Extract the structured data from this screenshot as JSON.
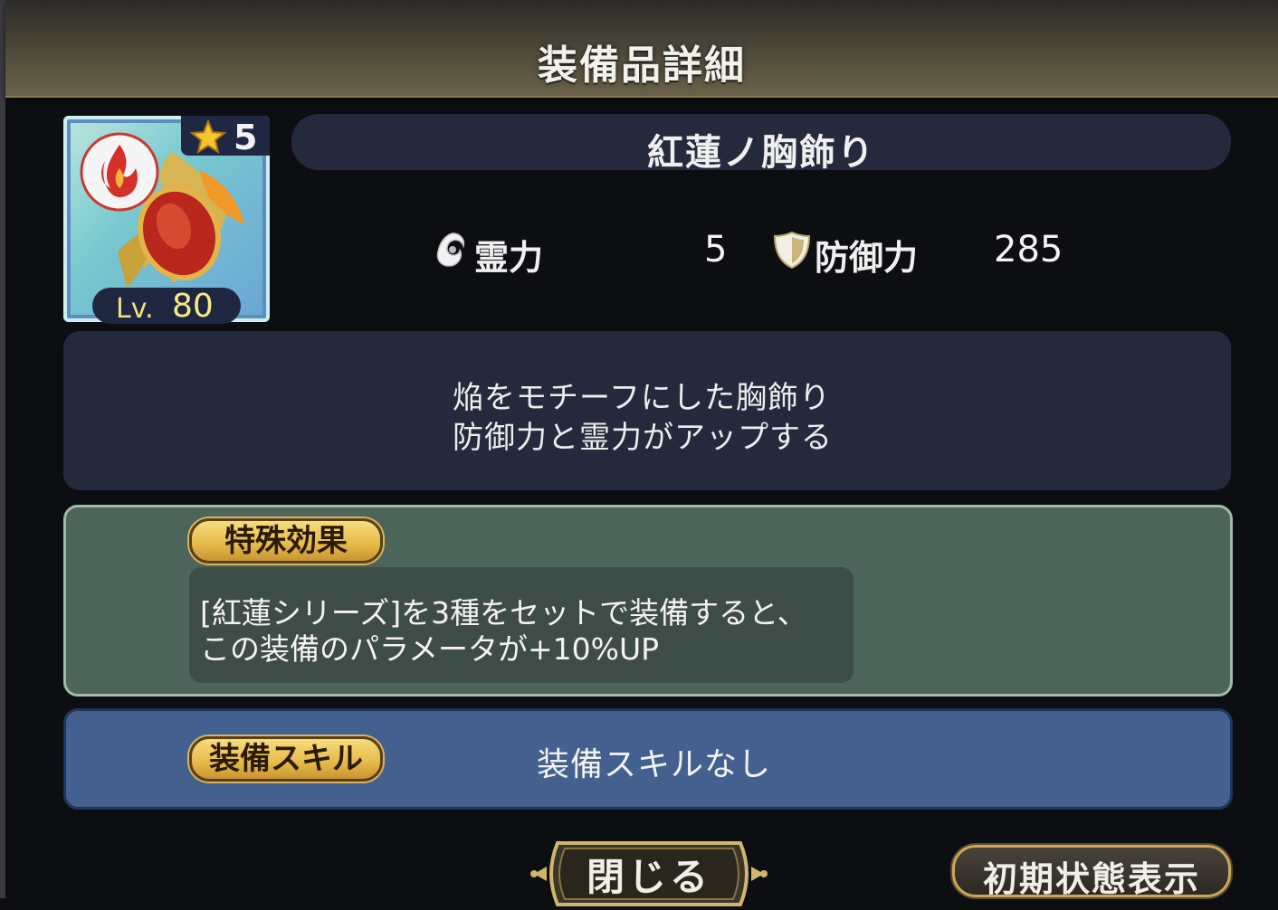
{
  "header": {
    "title": "装備品詳細"
  },
  "item": {
    "name": "紅蓮ノ胸飾り",
    "rarity": "5",
    "level_label": "Lv.",
    "level_value": "80"
  },
  "stats": [
    {
      "icon": "spirit-icon",
      "label": "霊力",
      "value": "5"
    },
    {
      "icon": "shield-icon",
      "label": "防御力",
      "value": "285"
    }
  ],
  "description": {
    "lines": [
      "焔をモチーフにした胸飾り",
      "防御力と霊力がアップする"
    ]
  },
  "special_effect": {
    "label": "特殊効果",
    "lines": [
      "[紅蓮シリーズ]を3種をセットで装備すると、",
      "この装備のパラメータが+10%UP"
    ]
  },
  "equip_skill": {
    "label": "装備スキル",
    "value": "装備スキルなし"
  },
  "buttons": {
    "close": "閉じる",
    "reset": "初期状態表示"
  },
  "colors": {
    "panel": "#242a3c",
    "effect_panel": "#4c6459",
    "skill_panel": "#44608e",
    "gold": "#e6b94a"
  }
}
